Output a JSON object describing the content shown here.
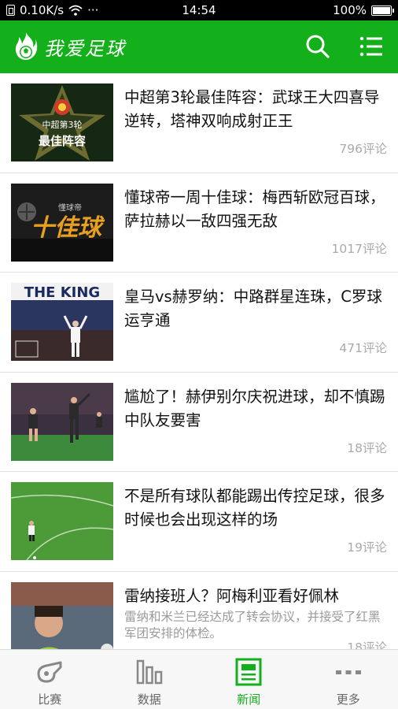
{
  "status_bar": {
    "network_speed": "0.10K/s",
    "time": "14:54",
    "battery": "100%",
    "battery_level": 1.0,
    "more_dots": "···"
  },
  "app_bar": {
    "title": "我爱足球",
    "accent_color": "#14b01b"
  },
  "news": [
    {
      "title": "中超第3轮最佳阵容：武球王大四喜导逆转，塔神双响成射正王",
      "comments": "796评论",
      "thumb_text_1": "中超第3轮",
      "thumb_text_2": "最佳阵容"
    },
    {
      "title": "懂球帝一周十佳球：梅西斩欧冠百球，萨拉赫以一敌四强无敌",
      "comments": "1017评论",
      "thumb_text_1": "懂球帝",
      "thumb_text_2": "十佳球"
    },
    {
      "title": "皇马vs赫罗纳：中路群星连珠，C罗球运亨通",
      "comments": "471评论",
      "thumb_text_1": "THE KING"
    },
    {
      "title": "尴尬了！赫伊别尔庆祝进球，却不慎踢中队友要害",
      "comments": "18评论"
    },
    {
      "title": "不是所有球队都能踢出传控足球，很多时候也会出现这样的场",
      "comments": "19评论"
    },
    {
      "title": "雷纳接班人？阿梅利亚看好佩林",
      "summary": "雷纳和米兰已经达成了转会协议，并接受了红黑军团安排的体检。",
      "comments": "18评论"
    }
  ],
  "bottom_nav": [
    {
      "label": "比赛",
      "icon": "whistle-icon"
    },
    {
      "label": "数据",
      "icon": "bar-chart-icon"
    },
    {
      "label": "新闻",
      "icon": "newspaper-icon",
      "active": true
    },
    {
      "label": "更多",
      "icon": "more-dots-icon"
    }
  ]
}
